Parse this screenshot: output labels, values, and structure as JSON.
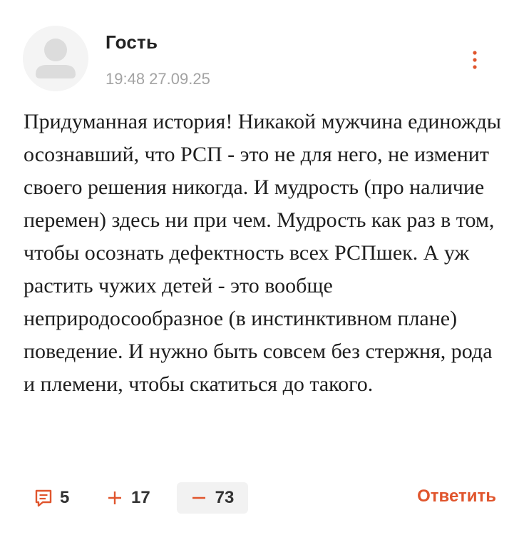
{
  "comment": {
    "author": "Гость",
    "timestamp": "19:48 27.09.25",
    "text": "Придуманная история! Никакой мужчина единожды осознавший, что РСП - это не для него, не изменит своего решения никогда. И мудрость (про наличие перемен) здесь ни при чем. Мудрость как раз в том, чтобы осознать дефектность всех РСПшек. А уж растить чужих детей - это вообще неприродосообразное (в инстинктивном плане) поведение. И нужно быть совсем без стержня, рода и племени, чтобы скатиться до такого."
  },
  "footer": {
    "replies_count": "5",
    "upvotes": "17",
    "downvotes": "73",
    "reply_label": "Ответить"
  },
  "icons": {
    "avatar": "user-silhouette-icon",
    "more": "vertical-dots-icon",
    "replies": "comment-bubble-icon",
    "upvote": "plus-icon",
    "downvote": "minus-icon"
  },
  "colors": {
    "accent": "#e0552d",
    "muted": "#a3a3a3",
    "avatar_bg": "#f4f4f4",
    "downvote_bg": "#f2f2f2"
  }
}
